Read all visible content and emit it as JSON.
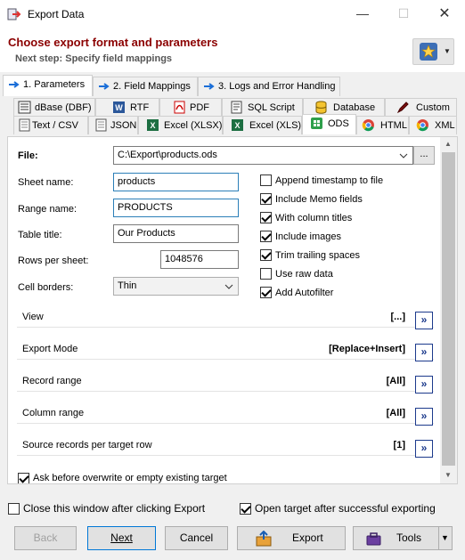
{
  "window": {
    "title": "Export Data"
  },
  "header": {
    "title": "Choose export format and parameters",
    "subtitle": "Next step: Specify field mappings"
  },
  "steps": [
    {
      "label": "1. Parameters",
      "active": true
    },
    {
      "label": "2. Field Mappings",
      "active": false
    },
    {
      "label": "3. Logs and Error Handling",
      "active": false
    }
  ],
  "formats_row1": [
    "dBase (DBF)",
    "RTF",
    "PDF",
    "SQL Script",
    "Database",
    "Custom"
  ],
  "formats_row2": [
    "Text / CSV",
    "JSON",
    "Excel (XLSX)",
    "Excel (XLS)",
    "ODS",
    "HTML",
    "XML"
  ],
  "selected_format": "ODS",
  "form": {
    "file_label": "File:",
    "file_value": "C:\\Export\\products.ods",
    "browse_label": "...",
    "sheet_label": "Sheet name:",
    "sheet_value": "products",
    "range_label": "Range name:",
    "range_value": "PRODUCTS",
    "table_title_label": "Table title:",
    "table_title_value": "Our Products",
    "rows_label": "Rows per sheet:",
    "rows_value": "1048576",
    "borders_label": "Cell borders:",
    "borders_value": "Thin"
  },
  "options": [
    {
      "label": "Append timestamp to file",
      "checked": false
    },
    {
      "label": "Include Memo fields",
      "checked": true
    },
    {
      "label": "With column titles",
      "checked": true
    },
    {
      "label": "Include images",
      "checked": true
    },
    {
      "label": "Trim trailing spaces",
      "checked": true
    },
    {
      "label": "Use raw data",
      "checked": false
    },
    {
      "label": "Add Autofilter",
      "checked": true
    }
  ],
  "groups": [
    {
      "label": "View",
      "value": "[...]"
    },
    {
      "label": "Export Mode",
      "value": "[Replace+Insert]"
    },
    {
      "label": "Record range",
      "value": "[All]"
    },
    {
      "label": "Column range",
      "value": "[All]"
    },
    {
      "label": "Source records per target row",
      "value": "[1]"
    }
  ],
  "ask_overwrite": {
    "label": "Ask before overwrite or empty existing target",
    "checked": true
  },
  "close_after": {
    "label": "Close this window after clicking Export",
    "checked": false
  },
  "open_target": {
    "label": "Open target after successful exporting",
    "checked": true
  },
  "buttons": {
    "back": "Back",
    "next": "Next",
    "cancel": "Cancel",
    "export": "Export",
    "tools": "Tools"
  },
  "colors": {
    "title_red": "#8b0000",
    "accent_blue": "#0078d7",
    "nav_blue": "#1c3a8c"
  }
}
